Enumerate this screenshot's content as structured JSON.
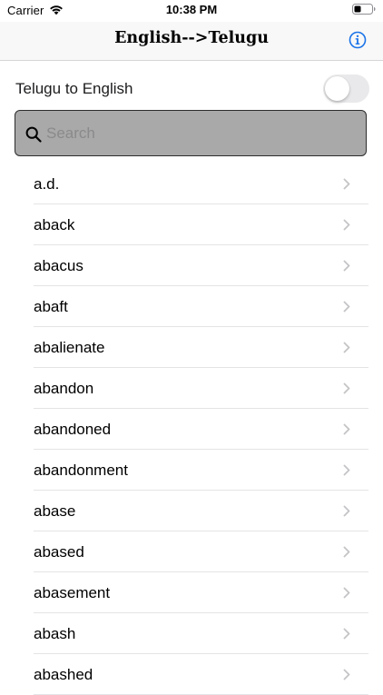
{
  "status_bar": {
    "carrier": "Carrier",
    "time": "10:38 PM",
    "icons": [
      "wifi-icon",
      "battery-icon"
    ]
  },
  "nav": {
    "title": "English-->Telugu",
    "info_icon": "info-icon",
    "accent_color": "#1a73e8"
  },
  "toggle": {
    "label": "Telugu to English",
    "on": false
  },
  "search": {
    "placeholder": "Search",
    "value": ""
  },
  "words": [
    "a.d.",
    "aback",
    "abacus",
    "abaft",
    "abalienate",
    "abandon",
    "abandoned",
    "abandonment",
    "abase",
    "abased",
    "abasement",
    "abash",
    "abashed"
  ]
}
